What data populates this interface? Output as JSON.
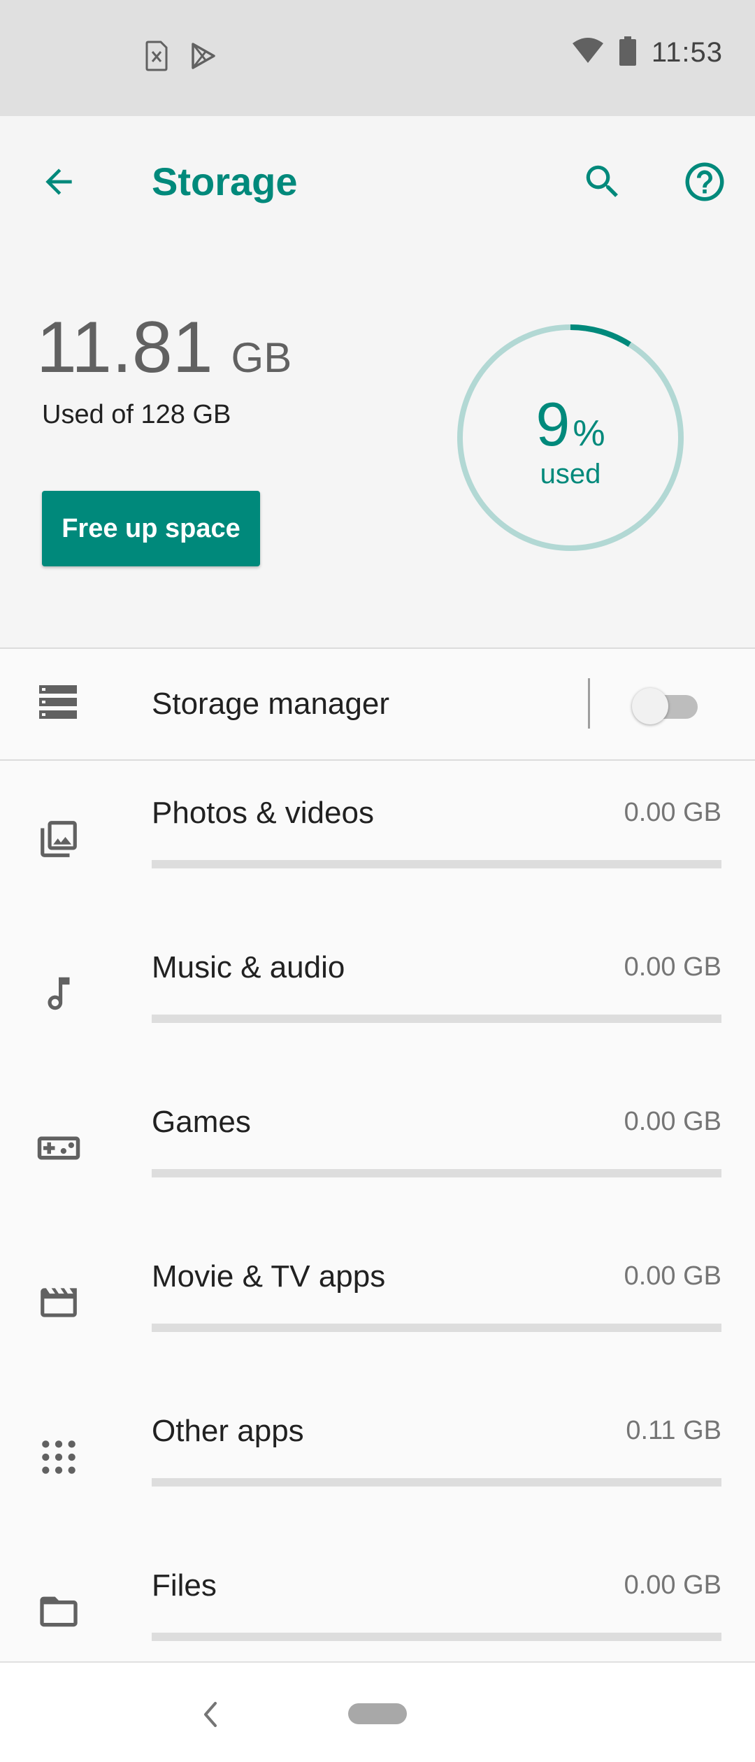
{
  "status_bar": {
    "time": "11:53",
    "icons": [
      "sim-off-icon",
      "play-store-icon",
      "wifi-icon",
      "battery-icon"
    ]
  },
  "header": {
    "title": "Storage",
    "used_number": "11.81",
    "used_unit": "GB",
    "used_of": "Used of 128 GB",
    "free_button_label": "Free up space",
    "ring": {
      "percent": "9",
      "percent_sign": "%",
      "label": "used",
      "fraction": 0.09
    }
  },
  "storage_manager": {
    "label": "Storage manager",
    "enabled": false
  },
  "categories": [
    {
      "label": "Photos & videos",
      "size": "0.00 GB",
      "fraction": 0,
      "icon": "photo-library-icon"
    },
    {
      "label": "Music & audio",
      "size": "0.00 GB",
      "fraction": 0,
      "icon": "music-note-icon"
    },
    {
      "label": "Games",
      "size": "0.00 GB",
      "fraction": 0,
      "icon": "gamepad-icon"
    },
    {
      "label": "Movie & TV apps",
      "size": "0.00 GB",
      "fraction": 0,
      "icon": "movie-clapper-icon"
    },
    {
      "label": "Other apps",
      "size": "0.11 GB",
      "fraction": 0,
      "icon": "apps-grid-icon"
    },
    {
      "label": "Files",
      "size": "0.00 GB",
      "fraction": 0,
      "icon": "folder-icon"
    }
  ],
  "colors": {
    "accent": "#00897b",
    "ring_track": "#b2d8d4"
  }
}
